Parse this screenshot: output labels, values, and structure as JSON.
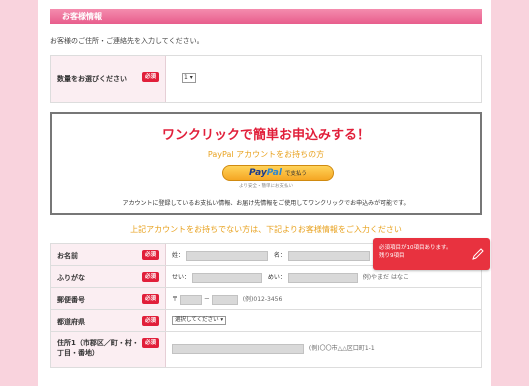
{
  "section": {
    "title": "お客様情報"
  },
  "intro": "お客様のご住所・ご連絡先を入力してください。",
  "quantity": {
    "label": "数量をお選びください",
    "required": "必須",
    "value": "1"
  },
  "paypal": {
    "headline": "ワンクリックで簡単お申込みする！",
    "subheadline": "PayPal アカウントをお持ちの方",
    "button_brand_a": "Pay",
    "button_brand_b": "Pal",
    "button_suffix": "で支払う",
    "button_note": "より安全・簡単にお支払い",
    "description": "アカウントに登録しているお支払い情報、お届け先情報をご使用してワンクリックでお申込みが可能です。"
  },
  "no_account_line": "上記アカウントをお持ちでない方は、下記よりお客様情報をご入力ください",
  "form": {
    "required": "必須",
    "name": {
      "label": "お名前",
      "sei": "姓：",
      "mei": "名："
    },
    "furigana": {
      "label": "ふりがな",
      "sei": "せい：",
      "mei": "めい：",
      "example": "例)やまだ はなこ"
    },
    "postal": {
      "label": "郵便番号",
      "prefix": "〒",
      "dash": "－",
      "example": "(例)012-3456"
    },
    "prefecture": {
      "label": "都道府県",
      "select": "選択してください"
    },
    "address": {
      "label": "住所1（市郡区／町・村・丁目・番地）",
      "example": "(例)〇〇市△△区口町1-1"
    }
  },
  "alert": {
    "line1": "必須項目が10項目あります。",
    "line2": "残り9項目"
  },
  "colors": {
    "accent": "#e85d8c",
    "required": "#e11f3a",
    "orange": "#e8a21f",
    "background": "#f9d3dd"
  }
}
